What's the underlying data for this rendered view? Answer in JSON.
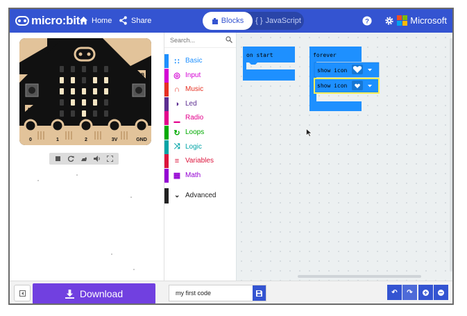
{
  "header": {
    "logo_text": "micro:bit",
    "home_label": "Home",
    "share_label": "Share",
    "tabs": [
      {
        "label": "Blocks"
      },
      {
        "label": "JavaScript"
      }
    ],
    "brand_label": "Microsoft",
    "colors": {
      "bar": "#3454d1",
      "tab_active_text": "#3454d1"
    }
  },
  "simulator": {
    "pins": [
      "0",
      "1",
      "2",
      "3V",
      "GND"
    ],
    "button_a": "A",
    "button_b": "B",
    "led_rows": [
      [
        0,
        0,
        0,
        0,
        0
      ],
      [
        1,
        1,
        0,
        1,
        1
      ],
      [
        1,
        1,
        1,
        1,
        1
      ],
      [
        0,
        1,
        1,
        1,
        0
      ],
      [
        0,
        0,
        1,
        0,
        0
      ]
    ],
    "controls": [
      "stop-icon",
      "restart-icon",
      "slow-motion-icon",
      "mute-icon",
      "fullscreen-icon"
    ]
  },
  "toolbox": {
    "search_placeholder": "Search...",
    "categories": [
      {
        "label": "Basic",
        "color": "#1e90ff",
        "icon": "grid-icon"
      },
      {
        "label": "Input",
        "color": "#d400d4",
        "icon": "target-icon"
      },
      {
        "label": "Music",
        "color": "#e63022",
        "icon": "headphones-icon"
      },
      {
        "label": "Led",
        "color": "#5c2d91",
        "icon": "toggle-icon"
      },
      {
        "label": "Radio",
        "color": "#e3008c",
        "icon": "signal-icon"
      },
      {
        "label": "Loops",
        "color": "#00aa00",
        "icon": "refresh-icon"
      },
      {
        "label": "Logic",
        "color": "#00a4a6",
        "icon": "shuffle-icon"
      },
      {
        "label": "Variables",
        "color": "#dc143c",
        "icon": "lines-icon"
      },
      {
        "label": "Math",
        "color": "#9400d3",
        "icon": "calculator-icon"
      }
    ],
    "advanced_label": "Advanced"
  },
  "workspace": {
    "on_start_label": "on start",
    "forever_label": "forever",
    "show_icon_label": "show icon",
    "block_color": "#1e90ff",
    "selected_outline": "#ffee55"
  },
  "bottom": {
    "download_label": "Download",
    "project_name": "my first code"
  }
}
